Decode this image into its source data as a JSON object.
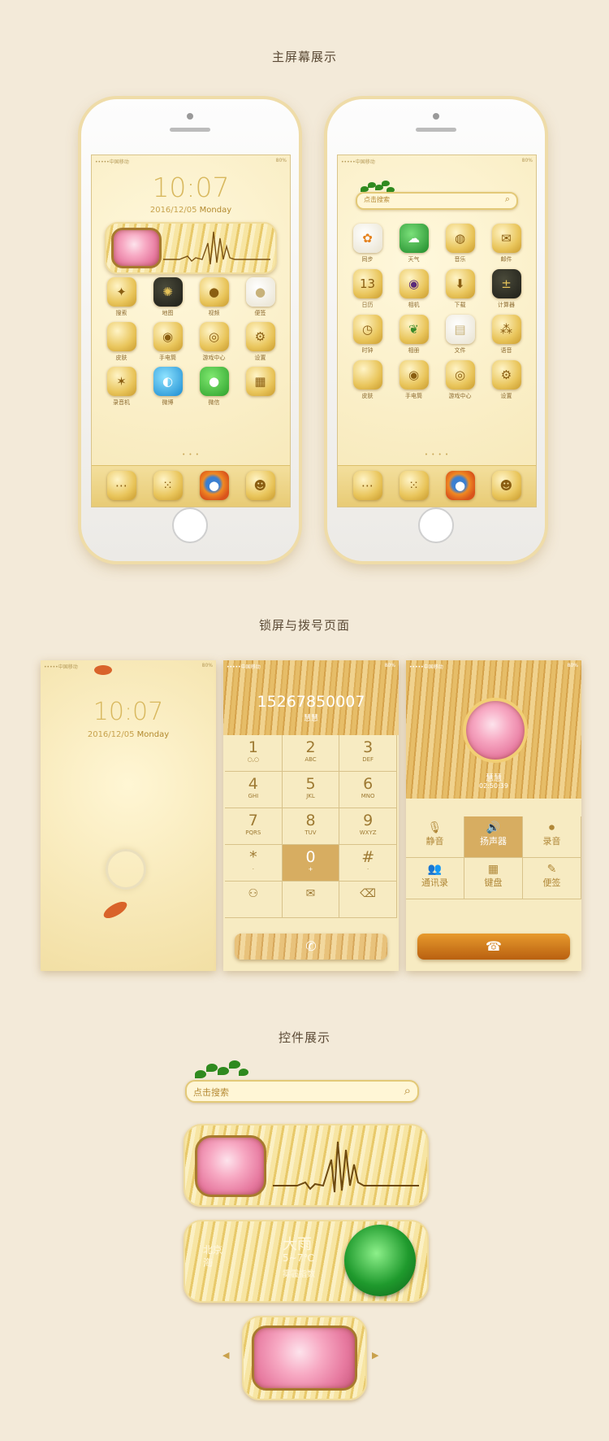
{
  "sections": {
    "home": "主屏幕展示",
    "lockdial": "锁屏与拨号页面",
    "widgets": "控件展示"
  },
  "status": {
    "carrier": "•••••中国移动",
    "battery": "80%"
  },
  "lockscreen": {
    "time": "10:07",
    "date": "2016/12/05",
    "weekday": "Monday"
  },
  "home1": {
    "apps": [
      {
        "label": "搜索",
        "icon": "compass-icon"
      },
      {
        "label": "地图",
        "icon": "web-icon"
      },
      {
        "label": "视频",
        "icon": "play-icon"
      },
      {
        "label": "便签",
        "icon": "note-icon"
      },
      {
        "label": "皮肤",
        "icon": "skin-icon"
      },
      {
        "label": "手电筒",
        "icon": "torch-icon"
      },
      {
        "label": "游戏中心",
        "icon": "game-icon"
      },
      {
        "label": "设置",
        "icon": "gear-icon"
      },
      {
        "label": "录音机",
        "icon": "recorder-icon"
      },
      {
        "label": "微博",
        "icon": "weibo-icon"
      },
      {
        "label": "微信",
        "icon": "wechat-icon"
      },
      {
        "label": "",
        "icon": "folder-icon"
      }
    ]
  },
  "home2": {
    "search_placeholder": "点击搜索",
    "apps": [
      {
        "label": "同步",
        "icon": "sync-icon"
      },
      {
        "label": "天气",
        "icon": "weather-icon"
      },
      {
        "label": "音乐",
        "icon": "music-icon"
      },
      {
        "label": "邮件",
        "icon": "mail-icon"
      },
      {
        "label": "日历",
        "icon": "calendar-icon",
        "glyph": "13"
      },
      {
        "label": "相机",
        "icon": "camera-icon"
      },
      {
        "label": "下载",
        "icon": "download-icon"
      },
      {
        "label": "计算器",
        "icon": "calculator-icon"
      },
      {
        "label": "时钟",
        "icon": "clock-icon"
      },
      {
        "label": "相册",
        "icon": "gallery-icon"
      },
      {
        "label": "文件",
        "icon": "file-icon"
      },
      {
        "label": "语音",
        "icon": "voice-icon"
      },
      {
        "label": "皮肤",
        "icon": "skin-icon"
      },
      {
        "label": "手电筒",
        "icon": "torch-icon"
      },
      {
        "label": "游戏中心",
        "icon": "game-icon"
      },
      {
        "label": "设置",
        "icon": "gear-icon"
      }
    ]
  },
  "dock": [
    "message-icon",
    "dialpad-icon",
    "firefox-icon",
    "contacts-icon"
  ],
  "dial": {
    "number": "15267850007",
    "name": "慧慧",
    "keys": [
      {
        "d": "1",
        "l": "○,○"
      },
      {
        "d": "2",
        "l": "ABC"
      },
      {
        "d": "3",
        "l": "DEF"
      },
      {
        "d": "4",
        "l": "GHI"
      },
      {
        "d": "5",
        "l": "JKL"
      },
      {
        "d": "6",
        "l": "MNO"
      },
      {
        "d": "7",
        "l": "PQRS"
      },
      {
        "d": "8",
        "l": "TUV"
      },
      {
        "d": "9",
        "l": "WXYZ"
      },
      {
        "d": "*",
        "l": "·"
      },
      {
        "d": "0",
        "l": "+"
      },
      {
        "d": "#",
        "l": "·"
      }
    ]
  },
  "call": {
    "name": "慧慧",
    "duration": "02:50:39",
    "controls": [
      {
        "g": "🎙",
        "n": "静音"
      },
      {
        "g": "🔊",
        "n": "扬声器"
      },
      {
        "g": "⏺",
        "n": "录音"
      },
      {
        "g": "👥",
        "n": "通讯录"
      },
      {
        "g": "▦",
        "n": "键盘"
      },
      {
        "g": "✎",
        "n": "便签"
      }
    ]
  },
  "weather": {
    "city": "北京",
    "district": "海",
    "condition": "大雨",
    "temp": "5~7℃",
    "note": "雾霾指数"
  },
  "colors": {
    "background": "#f3ead9",
    "gold": "#d8b85e",
    "wood": "#d7ad61"
  }
}
